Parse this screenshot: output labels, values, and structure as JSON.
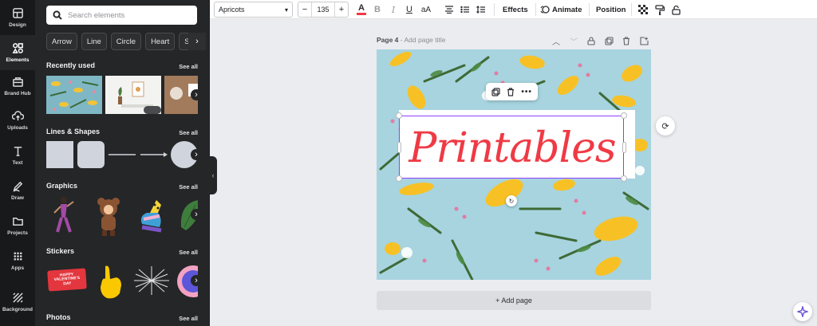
{
  "rail": {
    "items": [
      {
        "label": "Design",
        "icon": "design-icon"
      },
      {
        "label": "Elements",
        "icon": "elements-icon"
      },
      {
        "label": "Brand Hub",
        "icon": "brand-hub-icon"
      },
      {
        "label": "Uploads",
        "icon": "upload-icon"
      },
      {
        "label": "Text",
        "icon": "text-icon"
      },
      {
        "label": "Draw",
        "icon": "draw-icon"
      },
      {
        "label": "Projects",
        "icon": "folder-icon"
      },
      {
        "label": "Apps",
        "icon": "apps-icon"
      },
      {
        "label": "Background",
        "icon": "background-icon"
      }
    ],
    "active": "Elements"
  },
  "panel": {
    "search_placeholder": "Search elements",
    "chips": [
      "Arrow",
      "Line",
      "Circle",
      "Heart",
      "Square"
    ],
    "sections": {
      "recently_used": "Recently used",
      "lines_shapes": "Lines & Shapes",
      "graphics": "Graphics",
      "stickers": "Stickers",
      "photos": "Photos"
    },
    "see_all": "See all",
    "sticker_text": "HAPPY VALENTINE'S DAY"
  },
  "toolbar": {
    "font": "Apricots",
    "font_size": "135",
    "decrease": "−",
    "increase": "+",
    "effects": "Effects",
    "animate": "Animate",
    "position": "Position"
  },
  "page": {
    "label": "Page 4",
    "sep": " - ",
    "add_title": "Add page title",
    "headline": "Printables",
    "add_page": "+ Add page"
  },
  "colors": {
    "accent": "#8b3dff",
    "headline": "#ef3a45",
    "panel_bg": "#252627",
    "rail_bg": "#18191b"
  }
}
